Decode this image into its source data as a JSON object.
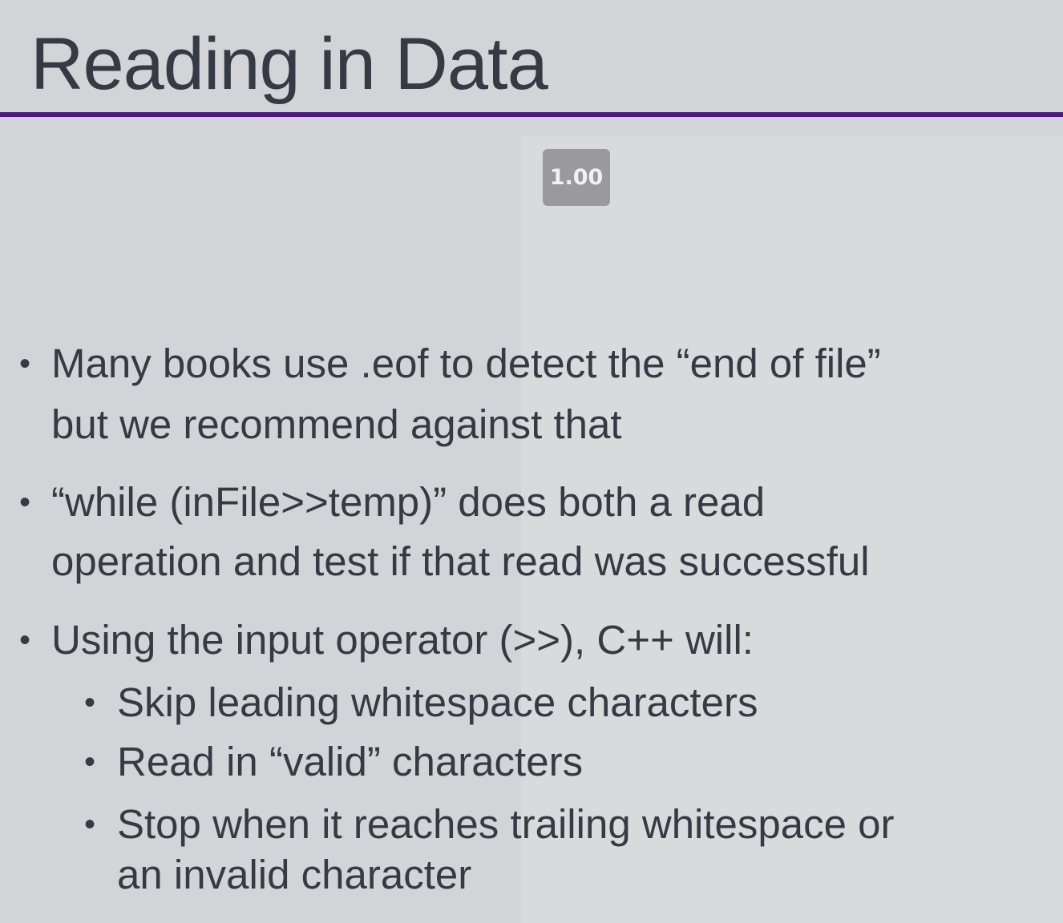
{
  "slide": {
    "title": "Reading in Data",
    "playback_speed": "1.00"
  },
  "bullets": [
    {
      "marker": "•",
      "lines": [
        "Many books use .eof to detect the “end of file”",
        "but we recommend against that"
      ]
    },
    {
      "marker": "•",
      "lines": [
        "“while (inFile>>temp)” does both a read",
        "operation and test if that read was successful"
      ]
    },
    {
      "marker": "•",
      "lines": [
        "Using the input operator (>>), C++ will:"
      ]
    }
  ],
  "sub_bullets": [
    {
      "marker": "•",
      "lines": [
        "Skip leading whitespace characters"
      ]
    },
    {
      "marker": "•",
      "lines": [
        "Read in “valid” characters"
      ]
    },
    {
      "marker": "•",
      "lines": [
        "Stop when it reaches trailing whitespace or",
        "an invalid character"
      ]
    }
  ],
  "colors": {
    "background": "#d3d4d7",
    "accent_rule": "#4c1a80",
    "text": "#343b45",
    "badge": "#9a9a9c"
  }
}
